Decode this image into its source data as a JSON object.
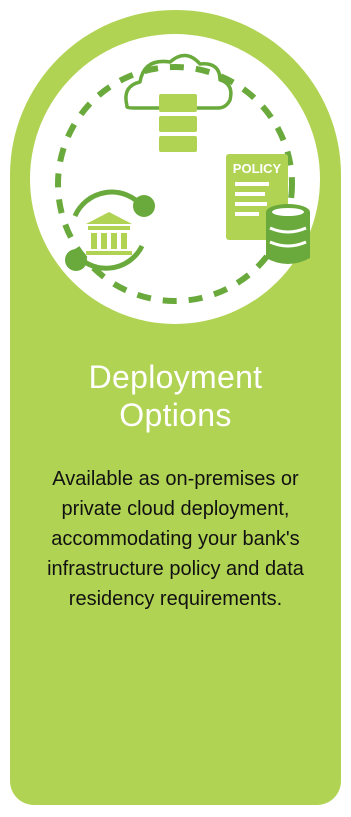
{
  "card": {
    "title_line1": "Deployment",
    "title_line2": "Options",
    "description": "Available as on-premises or private cloud deployment, accommodating your bank's infrastructure policy and data residency requirements.",
    "policy_label": "POLICY"
  },
  "colors": {
    "card_bg": "#b1d353",
    "accent_dark": "#6aaa3c",
    "white": "#ffffff",
    "text": "#111111"
  },
  "icons": [
    "cloud-icon",
    "server-stack-icon",
    "bank-icon",
    "policy-document-icon",
    "database-icon",
    "sync-arrows-icon"
  ]
}
